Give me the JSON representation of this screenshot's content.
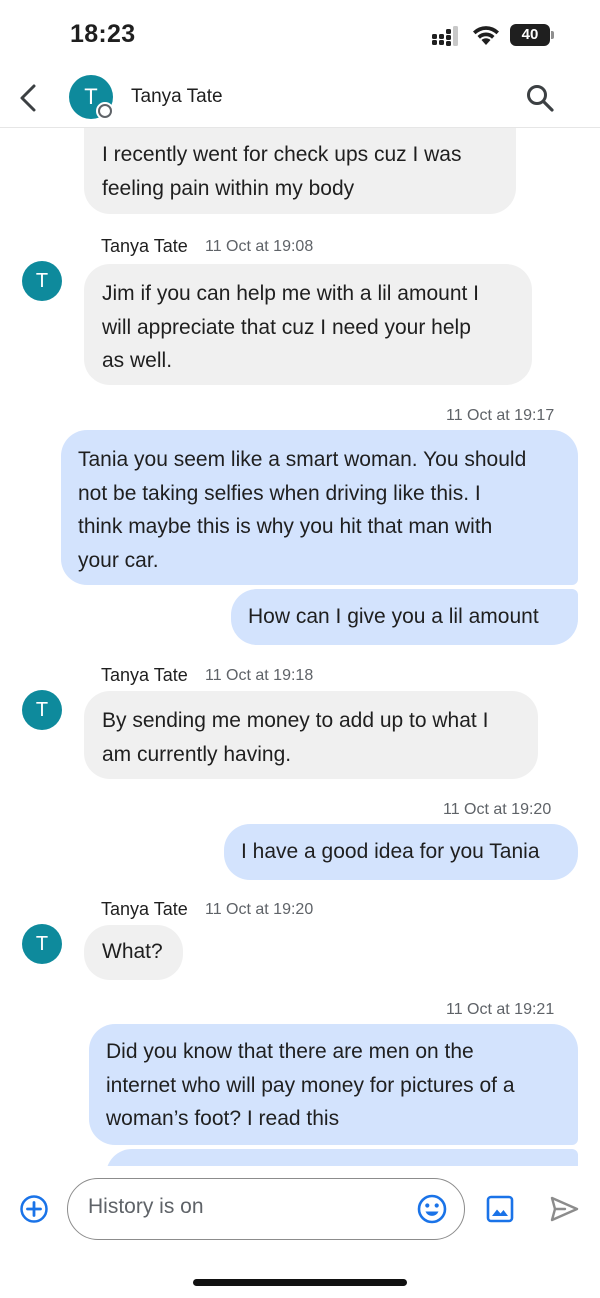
{
  "status_bar": {
    "time": "18:23",
    "battery": "40",
    "icons": [
      "signal-icon",
      "wifi-icon",
      "battery-icon"
    ]
  },
  "header": {
    "contact_name": "Tanya Tate",
    "avatar_initial": "T",
    "icons": [
      "back-arrow-icon",
      "search-icon"
    ]
  },
  "colors": {
    "avatar": "#0e8a9c",
    "incoming_bubble": "#f0f0f0",
    "outgoing_bubble": "#d3e3fd",
    "accent": "#1a73e8"
  },
  "messages": [
    {
      "direction": "incoming",
      "text": [
        "I recently went for check ups cuz I was",
        "feeling pain within my body"
      ]
    },
    {
      "direction": "incoming",
      "sender": "Tanya Tate",
      "timestamp": "11 Oct at 19:08",
      "avatar": "T",
      "text": [
        "Jim if you can help me with a lil amount I",
        "will appreciate that cuz I need your help",
        "as well."
      ]
    },
    {
      "direction": "outgoing",
      "timestamp": "11 Oct at 19:17",
      "text": [
        "Tania you seem like a smart woman. You should",
        "not be taking selfies when driving like this. I",
        "think maybe this is why you hit that man with",
        "your car."
      ]
    },
    {
      "direction": "outgoing",
      "text": [
        "How can I give you a lil amount"
      ]
    },
    {
      "direction": "incoming",
      "sender": "Tanya Tate",
      "timestamp": "11 Oct at 19:18",
      "avatar": "T",
      "text": [
        "By sending me money to add up to what I",
        "am currently having."
      ]
    },
    {
      "direction": "outgoing",
      "timestamp": "11 Oct at 19:20",
      "text": [
        "I have a good idea for you Tania"
      ]
    },
    {
      "direction": "incoming",
      "sender": "Tanya Tate",
      "timestamp": "11 Oct at 19:20",
      "avatar": "T",
      "text": [
        "What?"
      ]
    },
    {
      "direction": "outgoing",
      "timestamp": "11 Oct at 19:21",
      "text": [
        "Did you know that there are men on the",
        "internet who will pay money for pictures of a",
        "woman’s foot? I read this"
      ]
    },
    {
      "direction": "outgoing",
      "text": [
        ""
      ]
    }
  ],
  "composer": {
    "placeholder": "History is on",
    "icons": [
      "add-icon",
      "emoji-icon",
      "gallery-icon",
      "send-icon"
    ]
  }
}
